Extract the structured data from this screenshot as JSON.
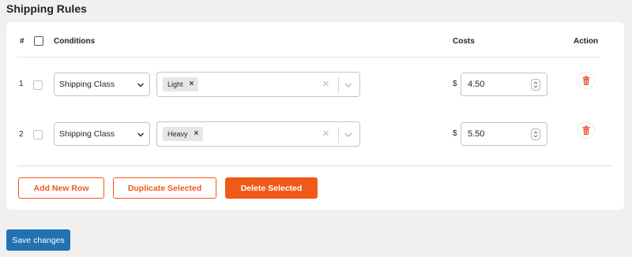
{
  "section_title": "Shipping Rules",
  "table": {
    "headers": {
      "number": "#",
      "conditions": "Conditions",
      "costs": "Costs",
      "action": "Action"
    },
    "rows": [
      {
        "number": "1",
        "condition_type": "Shipping Class",
        "tag": "Light",
        "tag_remove": "×",
        "clear": "×",
        "currency": "$",
        "cost": "4.50"
      },
      {
        "number": "2",
        "condition_type": "Shipping Class",
        "tag": "Heavy",
        "tag_remove": "×",
        "clear": "×",
        "currency": "$",
        "cost": "5.50"
      }
    ]
  },
  "buttons": {
    "add_row": "Add New Row",
    "duplicate": "Duplicate Selected",
    "delete": "Delete Selected",
    "save": "Save changes"
  },
  "icons": {
    "condition_dropdown": "chevron-down-icon",
    "tag_dropdown": "chevron-down-icon",
    "cost_spinner": "spinner-icon",
    "delete_row": "trash-icon"
  },
  "colors": {
    "accent": "#f05a18",
    "primary": "#2271b1",
    "trash": "#e9573f",
    "page_background": "#f0f0f1"
  }
}
